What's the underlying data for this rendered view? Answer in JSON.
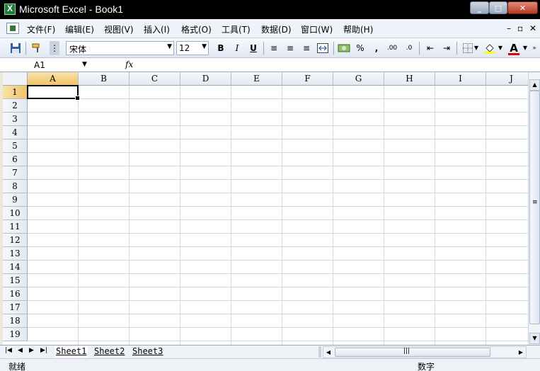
{
  "window": {
    "title": "Microsoft Excel - Book1",
    "minimize": "_",
    "maximize": "□",
    "close": "✕"
  },
  "menu": {
    "items": [
      "文件(F)",
      "编辑(E)",
      "视图(V)",
      "插入(I)",
      "格式(O)",
      "工具(T)",
      "数据(D)",
      "窗口(W)",
      "帮助(H)"
    ],
    "mdi": {
      "minimize": "–",
      "restore": "▫",
      "close": "✕"
    }
  },
  "toolbar": {
    "font_name": "宋体",
    "font_size": "12",
    "bold": "B",
    "italic": "I",
    "underline": "U",
    "percent": "%",
    "comma": ",",
    "increase_decimal": ".00",
    "decrease_decimal": ".0",
    "font_color_label": "A"
  },
  "formula_bar": {
    "name_box": "A1",
    "fx": "fx",
    "value": ""
  },
  "grid": {
    "columns": [
      "A",
      "B",
      "C",
      "D",
      "E",
      "F",
      "G",
      "H",
      "I",
      "J"
    ],
    "rows": [
      "1",
      "2",
      "3",
      "4",
      "5",
      "6",
      "7",
      "8",
      "9",
      "10",
      "11",
      "12",
      "13",
      "14",
      "15",
      "16",
      "17",
      "18",
      "19"
    ],
    "active_cell": "A1"
  },
  "sheets": [
    "Sheet1",
    "Sheet2",
    "Sheet3"
  ],
  "active_sheet": "Sheet1",
  "status": {
    "left": "就绪",
    "right": "数字"
  },
  "colors": {
    "title_bar": "#000000",
    "active_header": "#f0c36a",
    "grid_line": "#d0d7e0"
  }
}
